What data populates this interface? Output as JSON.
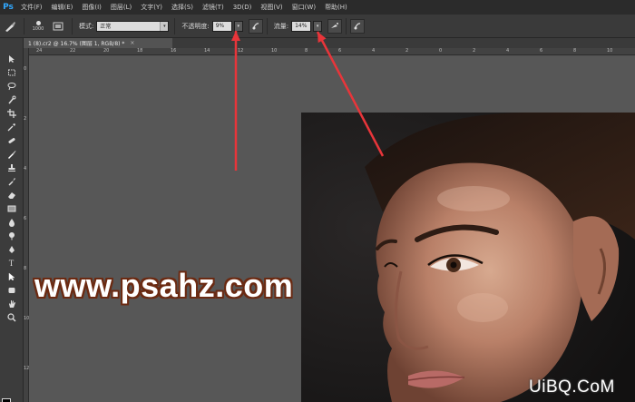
{
  "app": {
    "logo": "Ps"
  },
  "menu": [
    "文件(F)",
    "编辑(E)",
    "图像(I)",
    "图层(L)",
    "文字(Y)",
    "选择(S)",
    "滤镜(T)",
    "3D(D)",
    "视图(V)",
    "窗口(W)",
    "帮助(H)"
  ],
  "options": {
    "brush_size": "1000",
    "mode_label": "模式:",
    "mode_value": "正常",
    "opacity_label": "不透明度:",
    "opacity_value": "9%",
    "flow_label": "流量:",
    "flow_value": "14%"
  },
  "document": {
    "tab_title": "1 (8).cr2 @ 16.7% (图层 1, RGB/8) *",
    "close": "×"
  },
  "ruler": {
    "h_ticks": [
      "24",
      "22",
      "20",
      "18",
      "16",
      "14",
      "12",
      "10",
      "8",
      "6",
      "4",
      "2",
      "0",
      "2",
      "4",
      "6",
      "8",
      "10"
    ],
    "v_ticks": [
      "0",
      "2",
      "4",
      "6",
      "8",
      "10",
      "12"
    ]
  },
  "toolbar": {
    "tools": [
      "move-tool",
      "marquee-tool",
      "lasso-tool",
      "quick-select-tool",
      "crop-tool",
      "eyedropper-tool",
      "healing-tool",
      "brush-tool",
      "clone-stamp-tool",
      "history-brush-tool",
      "eraser-tool",
      "gradient-tool",
      "blur-tool",
      "dodge-tool",
      "pen-tool",
      "type-tool",
      "path-select-tool",
      "shape-tool",
      "hand-tool",
      "zoom-tool"
    ],
    "foreground_color": "#000000",
    "background_color": "#ffffff"
  },
  "watermarks": {
    "site": "www.psahz.com",
    "corner": "UiBQ.CoM"
  },
  "colors": {
    "arrow": "#e8353a",
    "accent": "#31a8ff"
  }
}
